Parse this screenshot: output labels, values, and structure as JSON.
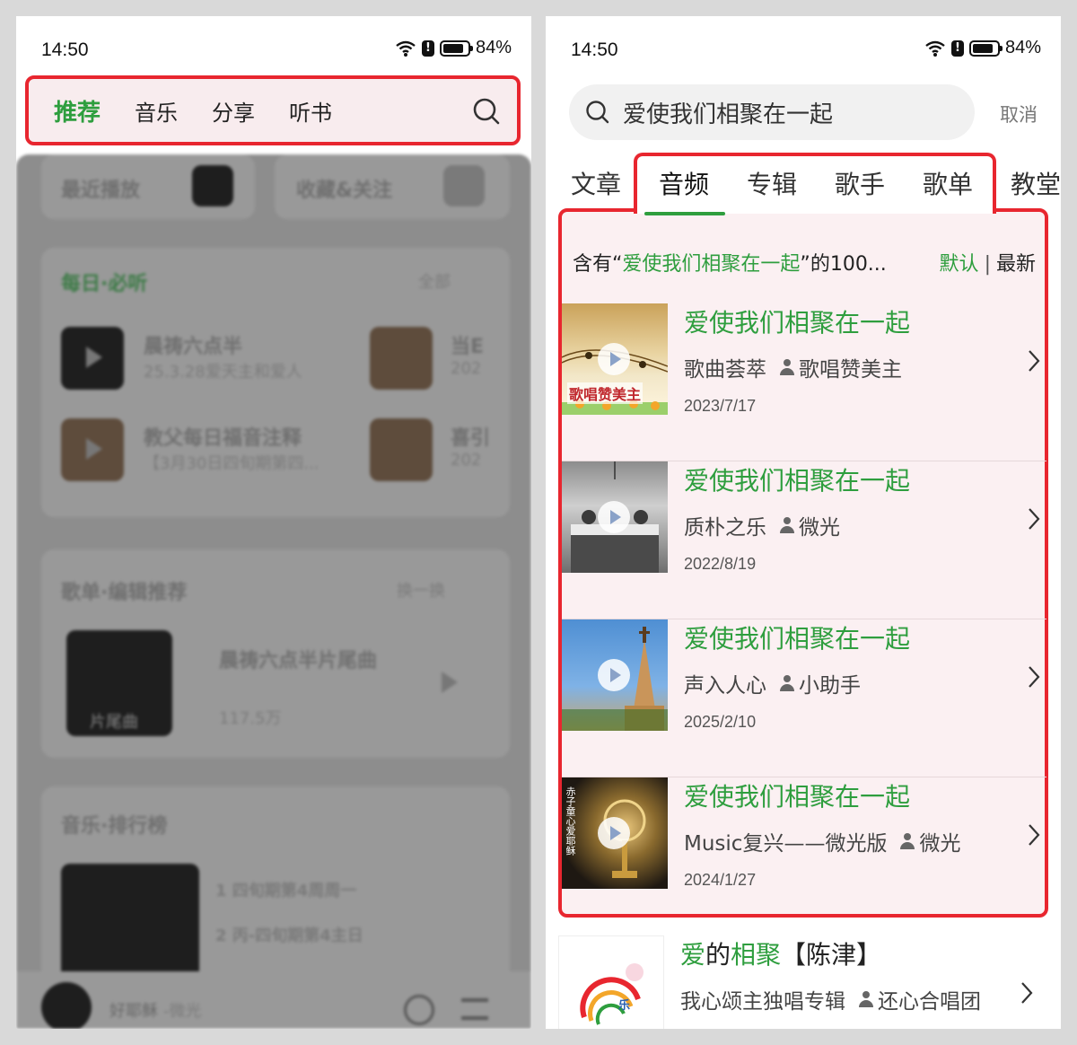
{
  "left": {
    "status": {
      "time": "14:50",
      "battery": "84%"
    },
    "nav": {
      "tabs": [
        "推荐",
        "音乐",
        "分享",
        "听书"
      ],
      "active_index": 0
    },
    "blurred": {
      "recent": "最近播放",
      "favorites": "收藏&关注",
      "daily_title": "每日·必听",
      "daily_more": "全部",
      "daily_items": [
        {
          "title": "晨祷六点半",
          "sub": "25.3.28爱天主和爱人"
        },
        {
          "title": "当E",
          "sub": "202"
        },
        {
          "title": "教父每日福音注释",
          "sub": "【3月30日四旬期第四..."
        },
        {
          "title": "喜引",
          "sub": "202"
        }
      ],
      "playlist_title": "歌单·编辑推荐",
      "playlist_refresh": "换一换",
      "playlist_item": {
        "title": "晨祷六点半片尾曲",
        "plays": "117.5万",
        "cover_text": "片尾曲"
      },
      "rank_title": "音乐·排行榜",
      "rank_items": [
        "1  四旬期第4周周一",
        "2  丙-四旬期第4主日"
      ],
      "player": {
        "song": "好耶稣",
        "artist": "-微光"
      }
    }
  },
  "right": {
    "status": {
      "time": "14:50",
      "battery": "84%"
    },
    "search": {
      "query": "爱使我们相聚在一起",
      "cancel": "取消"
    },
    "categories": [
      "文章",
      "音频",
      "专辑",
      "歌手",
      "歌单",
      "教堂"
    ],
    "active_category": 1,
    "summary": {
      "prefix": "含有“",
      "keyword": "爱使我们相聚在一起",
      "suffix": "”的100...",
      "sort_default": "默认",
      "sort_latest": "最新"
    },
    "results": [
      {
        "title": "爱使我们相聚在一起",
        "album": "歌曲荟萃",
        "author": "歌唱赞美主",
        "date": "2023/7/17",
        "thumb_text": "歌唱赞美主"
      },
      {
        "title": "爱使我们相聚在一起",
        "album": "质朴之乐",
        "author": "微光",
        "date": "2022/8/19"
      },
      {
        "title": "爱使我们相聚在一起",
        "album": "声入人心",
        "author": "小助手",
        "date": "2025/2/10"
      },
      {
        "title": "爱使我们相聚在一起",
        "album": "Music复兴——微光版",
        "author": "微光",
        "date": "2024/1/27",
        "thumb_text": "赤子童心爱耶稣"
      }
    ],
    "extra_result": {
      "title_hl1": "爱",
      "title_plain1": "的",
      "title_hl2": "相聚",
      "title_plain2": "【陈津】",
      "album": "我心颂主独唱专辑",
      "author": "还心合唱团",
      "thumb_text": "乐"
    }
  }
}
